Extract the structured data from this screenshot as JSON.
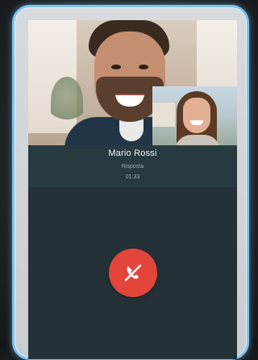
{
  "call": {
    "caller_name": "Mario Rossi",
    "status": "Risposta",
    "duration": "01:33"
  },
  "controls": {
    "hangup_icon": "phone-hangup-icon"
  },
  "colors": {
    "frame_accent": "#7ec3ee",
    "screen_bg": "#243238",
    "hangup": "#e3453a"
  }
}
